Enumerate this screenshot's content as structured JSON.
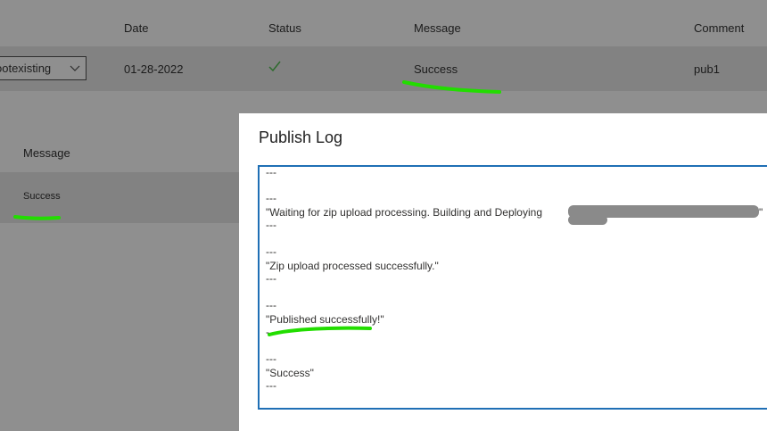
{
  "table": {
    "headers": {
      "date": "Date",
      "status": "Status",
      "message": "Message",
      "comment": "Comment"
    },
    "row": {
      "select_value": "ootexisting",
      "date": "01-28-2022",
      "status_icon": "checkmark-icon",
      "message": "Success",
      "comment": "pub1"
    }
  },
  "details": {
    "header": "Message",
    "row_message": "Success"
  },
  "dialog": {
    "title": "Publish Log",
    "lines": [
      "---",
      "---",
      "\"Waiting for zip upload processing. Building and Deploying",
      "\"",
      "---",
      "---",
      "\"Zip upload processed successfully.\"",
      "---",
      "---",
      "\"Published successfully!\"",
      "-",
      "---",
      "\"Success\"",
      "---"
    ]
  },
  "colors": {
    "highlight": "#22dd00",
    "focus_border": "#1f6fb5",
    "check": "#2e7d32"
  }
}
